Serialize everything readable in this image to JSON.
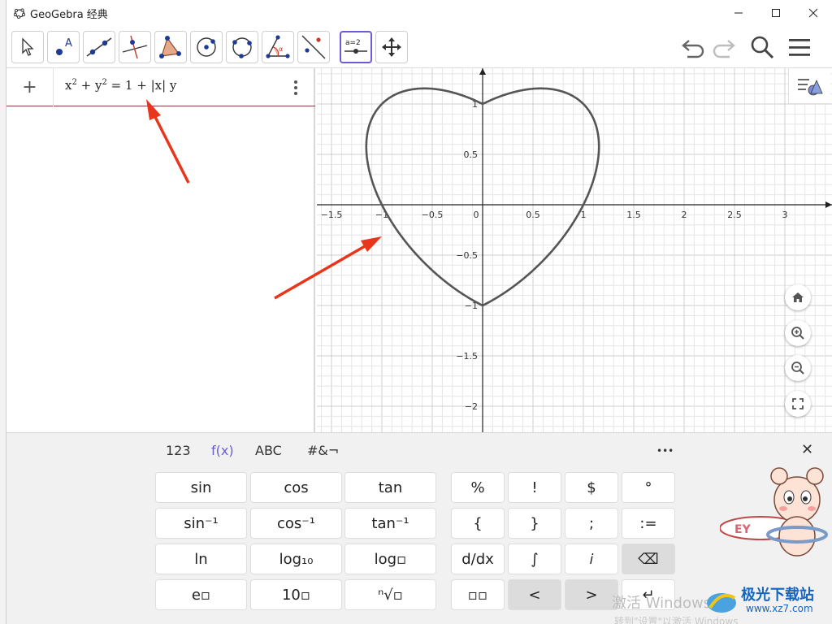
{
  "window": {
    "title": "GeoGebra 经典"
  },
  "toolbar": {
    "tools": [
      "move-tool",
      "point-tool",
      "line-tool",
      "perpendicular-line-tool",
      "polygon-tool",
      "circle-center-tool",
      "conic-tool",
      "angle-tool",
      "reflect-tool",
      "slider-tool",
      "move-graphics-view-tool"
    ],
    "slider_label": "a=2",
    "right": [
      "undo",
      "redo",
      "search",
      "menu"
    ]
  },
  "algebra": {
    "add_label": "+",
    "expr": {
      "x": "x",
      "sup1": "2",
      "plus": " + y",
      "sup2": "2",
      "rest": " = 1 + |x| y"
    }
  },
  "graphics": {
    "x_ticks": [
      "−1.5",
      "−1",
      "−0.5",
      "0",
      "0.5",
      "1",
      "1.5",
      "2",
      "2.5",
      "3"
    ],
    "y_ticks": [
      "1",
      "0.5",
      "−0.5",
      "−1",
      "−1.5",
      "−2"
    ],
    "curve": "x² + y² = 1 + |x| y",
    "curve_color": "#555555",
    "axis_color": "#222222",
    "grid_color": "#e6e6e6"
  },
  "side_buttons": [
    "home-icon",
    "zoom-in-icon",
    "zoom-out-icon",
    "fullscreen-icon"
  ],
  "keyboard": {
    "tabs": [
      "123",
      "f(x)",
      "ABC",
      "#&¬"
    ],
    "active_tab": "f(x)",
    "more": "•••",
    "close": "✕",
    "rows": [
      [
        "sin",
        "cos",
        "tan",
        "%",
        "!",
        "$",
        "°"
      ],
      [
        "sin⁻¹",
        "cos⁻¹",
        "tan⁻¹",
        "{",
        "}",
        ";",
        ":="
      ],
      [
        "ln",
        "log₁₀",
        "log▫",
        "d/dx",
        "∫",
        "𝑖",
        "⌫"
      ],
      [
        "e▫",
        "10▫",
        "ⁿ√▫",
        "▫▫",
        "<",
        ">",
        "↵"
      ]
    ]
  },
  "overlay": {
    "watermark": "激活 Windows",
    "watermark2": "转到\"设置\"以激活 Windows",
    "brand_name": "极光下载站",
    "brand_url": "www.xz7.com",
    "mascot_label": "EY"
  }
}
